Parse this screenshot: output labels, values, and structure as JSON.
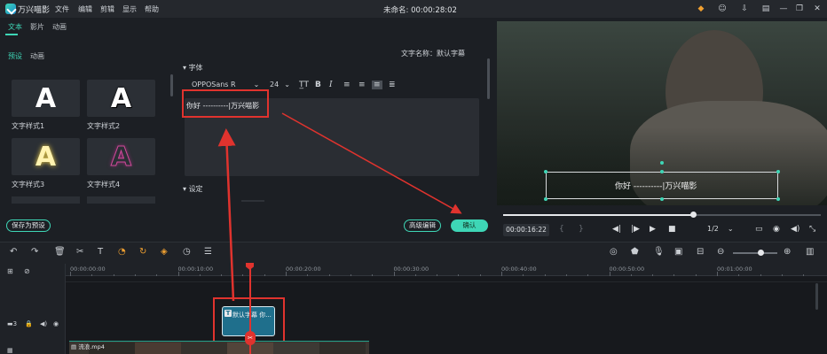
{
  "app": {
    "title": "万兴喵影",
    "doc_title": "未命名: 00:00:28:02"
  },
  "menu": [
    "文件",
    "编辑",
    "剪辑",
    "显示",
    "帮助"
  ],
  "tabs": [
    "文本",
    "影片",
    "动画"
  ],
  "subtabs": [
    "预设",
    "动画"
  ],
  "presets": [
    {
      "label": "文字样式1",
      "glyph": "A"
    },
    {
      "label": "文字样式2",
      "glyph": "A"
    },
    {
      "label": "文字样式3",
      "glyph": "A"
    },
    {
      "label": "文字样式4",
      "glyph": "A"
    }
  ],
  "save_preset": "保存为预设",
  "editor": {
    "name_label": "文字名称：默认字幕",
    "font_section": "字体",
    "settings_section": "设定",
    "font_name": "OPPOSans R",
    "font_size": "24",
    "text_value": "你好 ----------|万兴喵影"
  },
  "buttons": {
    "advanced": "高级编辑",
    "ok": "确认"
  },
  "preview": {
    "subtitle": "你好 ----------|万兴喵影",
    "current_time": "00:00:16:22",
    "quality": "1/2",
    "progress": 0.6
  },
  "ruler": {
    "labels": [
      "00:00:00:00",
      "00:00:10:00",
      "00:00:20:00",
      "00:00:30:00",
      "00:00:40:00",
      "00:00:50:00",
      "00:01:00:00"
    ]
  },
  "timeline": {
    "title_clip": "默认字幕 你...",
    "video_clip": "流浪.mp4",
    "track_number": "3"
  },
  "colors": {
    "accent": "#3ed6b6",
    "annotation": "#e0332e",
    "clip": "#1f6f8c"
  }
}
